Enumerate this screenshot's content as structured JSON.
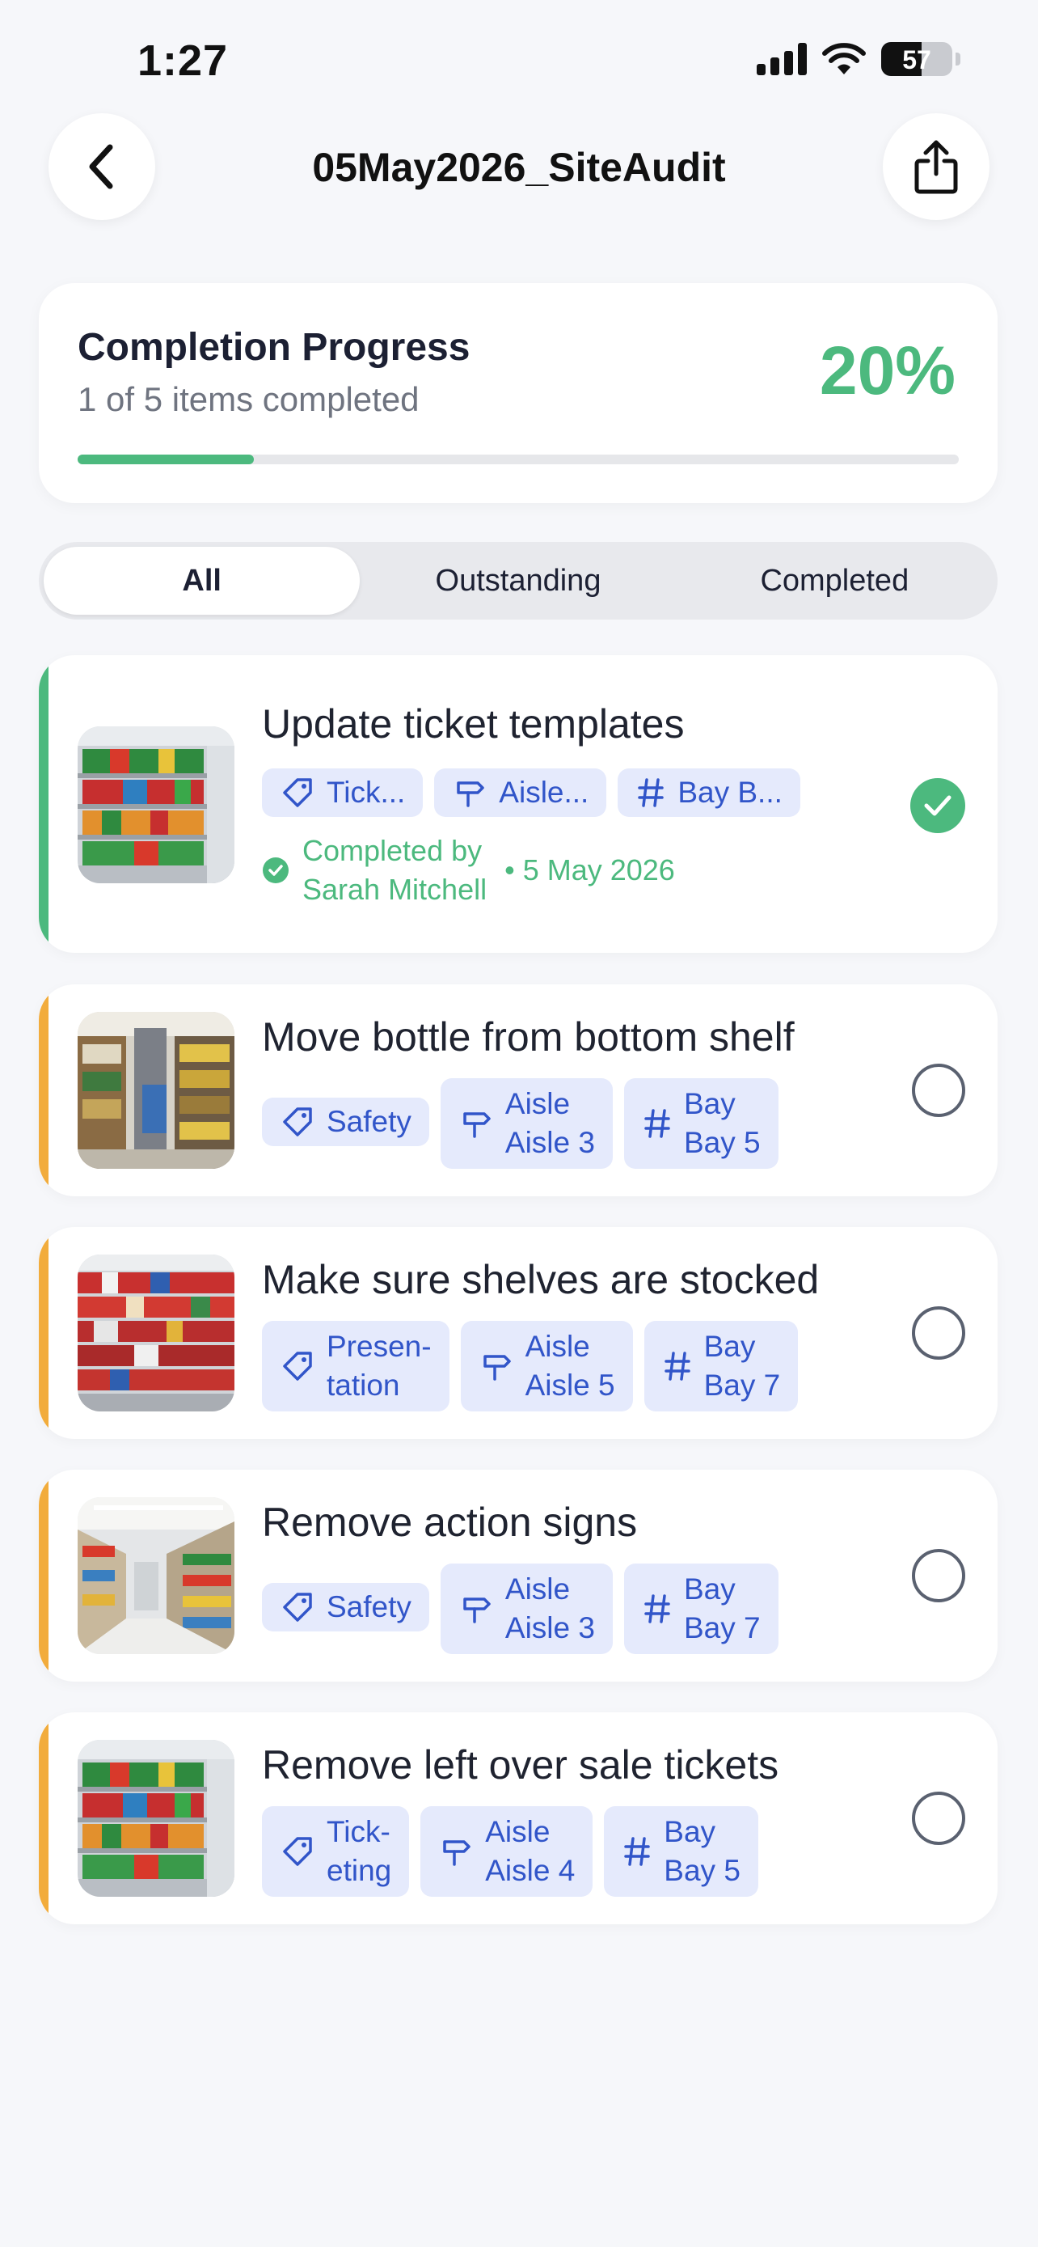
{
  "status_bar": {
    "time": "1:27",
    "battery": "57",
    "battery_level": 0.57
  },
  "header": {
    "title": "05May2026_SiteAudit",
    "back_icon": "chevron-left-icon",
    "share_icon": "share-icon"
  },
  "progress": {
    "title": "Completion Progress",
    "subtitle": "1 of 5 items completed",
    "percent_label": "20%",
    "value": 0.2,
    "color": "#4cb97e"
  },
  "filters": {
    "all": "All",
    "outstanding": "Outstanding",
    "completed": "Completed",
    "selected": "All"
  },
  "colors": {
    "completed_accent": "#4cb97e",
    "outstanding_accent": "#f2ac3c",
    "tag_bg": "#e5eafc",
    "tag_text": "#3155c9"
  },
  "tasks": [
    {
      "title": "Update ticket templates",
      "status": "completed",
      "tags": {
        "category": "Tick...",
        "aisle": "Aisle...",
        "bay": "Bay B..."
      },
      "completed_by": "Completed by\nSarah Mitchell",
      "completed_date": "• 5 May 2026"
    },
    {
      "title": "Move bottle from bottom shelf",
      "status": "outstanding",
      "tags": {
        "category": "Safety",
        "aisle": "Aisle\nAisle 3",
        "bay": "Bay\nBay 5"
      }
    },
    {
      "title": "Make sure shelves are stocked",
      "status": "outstanding",
      "tags": {
        "category": "Presen-\ntation",
        "aisle": "Aisle\nAisle 5",
        "bay": "Bay\nBay 7"
      }
    },
    {
      "title": "Remove action signs",
      "status": "outstanding",
      "tags": {
        "category": "Safety",
        "aisle": "Aisle\nAisle 3",
        "bay": "Bay\nBay 7"
      }
    },
    {
      "title": "Remove left over sale tickets",
      "status": "outstanding",
      "tags": {
        "category": "Tick-\neting",
        "aisle": "Aisle\nAisle 4",
        "bay": "Bay\nBay 5"
      }
    }
  ]
}
